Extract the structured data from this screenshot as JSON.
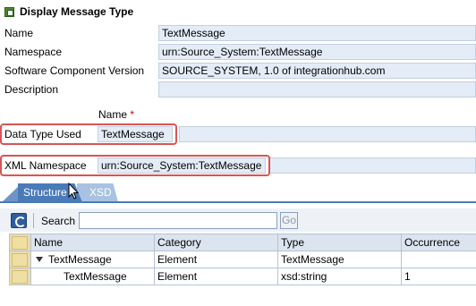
{
  "header": {
    "title": "Display Message Type"
  },
  "form": {
    "name_label": "Name",
    "name_value": "TextMessage",
    "namespace_label": "Namespace",
    "namespace_value": "urn:Source_System:TextMessage",
    "swc_label": "Software Component Version",
    "swc_value": "SOURCE_SYSTEM, 1.0 of integrationhub.com",
    "description_label": "Description",
    "description_value": ""
  },
  "data_type": {
    "column_label": "Name",
    "required_marker": "*",
    "label": "Data Type Used",
    "value": "TextMessage"
  },
  "xml_namespace": {
    "label": "XML Namespace",
    "value": "urn:Source_System:TextMessage"
  },
  "tabs": [
    {
      "label": "Structure",
      "active": true
    },
    {
      "label": "XSD",
      "active": false
    }
  ],
  "toolbar": {
    "search_label": "Search",
    "search_value": "",
    "go_label": "Go"
  },
  "table": {
    "columns": [
      "Name",
      "Category",
      "Type",
      "Occurrence"
    ],
    "rows": [
      {
        "name": "TextMessage",
        "category": "Element",
        "type": "TextMessage",
        "occurrence": "",
        "expanded": true
      },
      {
        "name": "TextMessage",
        "category": "Element",
        "type": "xsd:string",
        "occurrence": "1",
        "expanded": false
      }
    ]
  },
  "colors": {
    "highlight": "#d95454",
    "tab_active": "#4a7bb8",
    "field_bg": "#e4ecf7"
  }
}
